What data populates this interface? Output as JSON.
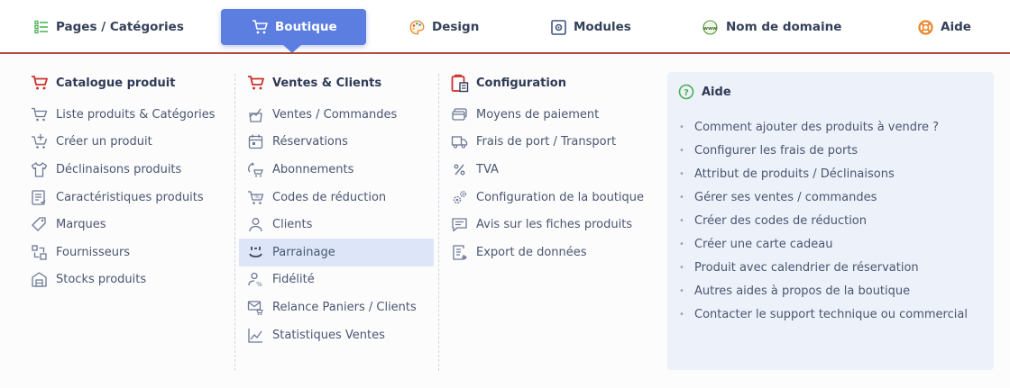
{
  "colors": {
    "accent": "#5b7ee0",
    "rule": "#b44b3d",
    "icon_red": "#c9302c",
    "help_bg": "#edf1fa",
    "highlight": "#dde6f9"
  },
  "nav": {
    "items": [
      {
        "label": "Pages / Catégories",
        "icon": "list-icon"
      },
      {
        "label": "Boutique",
        "icon": "cart-icon",
        "active": true
      },
      {
        "label": "Design",
        "icon": "palette-icon"
      },
      {
        "label": "Modules",
        "icon": "module-icon"
      },
      {
        "label": "Nom de domaine",
        "icon": "www-icon"
      },
      {
        "label": "Aide",
        "icon": "lifebuoy-icon"
      }
    ]
  },
  "menu": {
    "col1": {
      "title": "Catalogue produit",
      "items": [
        {
          "label": "Liste produits & Catégories",
          "icon": "cart-icon"
        },
        {
          "label": "Créer un produit",
          "icon": "cart-plus-icon"
        },
        {
          "label": "Déclinaisons produits",
          "icon": "shirt-icon"
        },
        {
          "label": "Caractéristiques produits",
          "icon": "list-check-icon"
        },
        {
          "label": "Marques",
          "icon": "tag-icon"
        },
        {
          "label": "Fournisseurs",
          "icon": "supplier-icon"
        },
        {
          "label": "Stocks produits",
          "icon": "warehouse-icon"
        }
      ]
    },
    "col2": {
      "title": "Ventes & Clients",
      "items": [
        {
          "label": "Ventes / Commandes",
          "icon": "chart-bag-icon"
        },
        {
          "label": "Réservations",
          "icon": "calendar-icon"
        },
        {
          "label": "Abonnements",
          "icon": "cart-refresh-icon"
        },
        {
          "label": "Codes de réduction",
          "icon": "cart-discount-icon"
        },
        {
          "label": "Clients",
          "icon": "user-icon"
        },
        {
          "label": "Parrainage",
          "icon": "referral-icon",
          "highlighted": true
        },
        {
          "label": "Fidélité",
          "icon": "user-percent-icon"
        },
        {
          "label": "Relance Paniers / Clients",
          "icon": "mail-cart-icon"
        },
        {
          "label": "Statistiques Ventes",
          "icon": "line-chart-icon"
        }
      ]
    },
    "col3": {
      "title": "Configuration",
      "items": [
        {
          "label": "Moyens de paiement",
          "icon": "card-icon"
        },
        {
          "label": "Frais de port / Transport",
          "icon": "truck-icon"
        },
        {
          "label": "TVA",
          "icon": "percent-icon"
        },
        {
          "label": "Configuration de la boutique",
          "icon": "gears-icon"
        },
        {
          "label": "Avis sur les fiches produits",
          "icon": "comment-icon"
        },
        {
          "label": "Export de données",
          "icon": "export-icon"
        }
      ]
    },
    "help": {
      "title": "Aide",
      "links": [
        "Comment ajouter des produits à vendre ?",
        "Configurer les frais de ports",
        "Attribut de produits / Déclinaisons",
        "Gérer ses ventes / commandes",
        "Créer des codes de réduction",
        "Créer une carte cadeau",
        "Produit avec calendrier de réservation",
        "Autres aides à propos de la boutique",
        "Contacter le support technique ou commercial"
      ]
    }
  }
}
